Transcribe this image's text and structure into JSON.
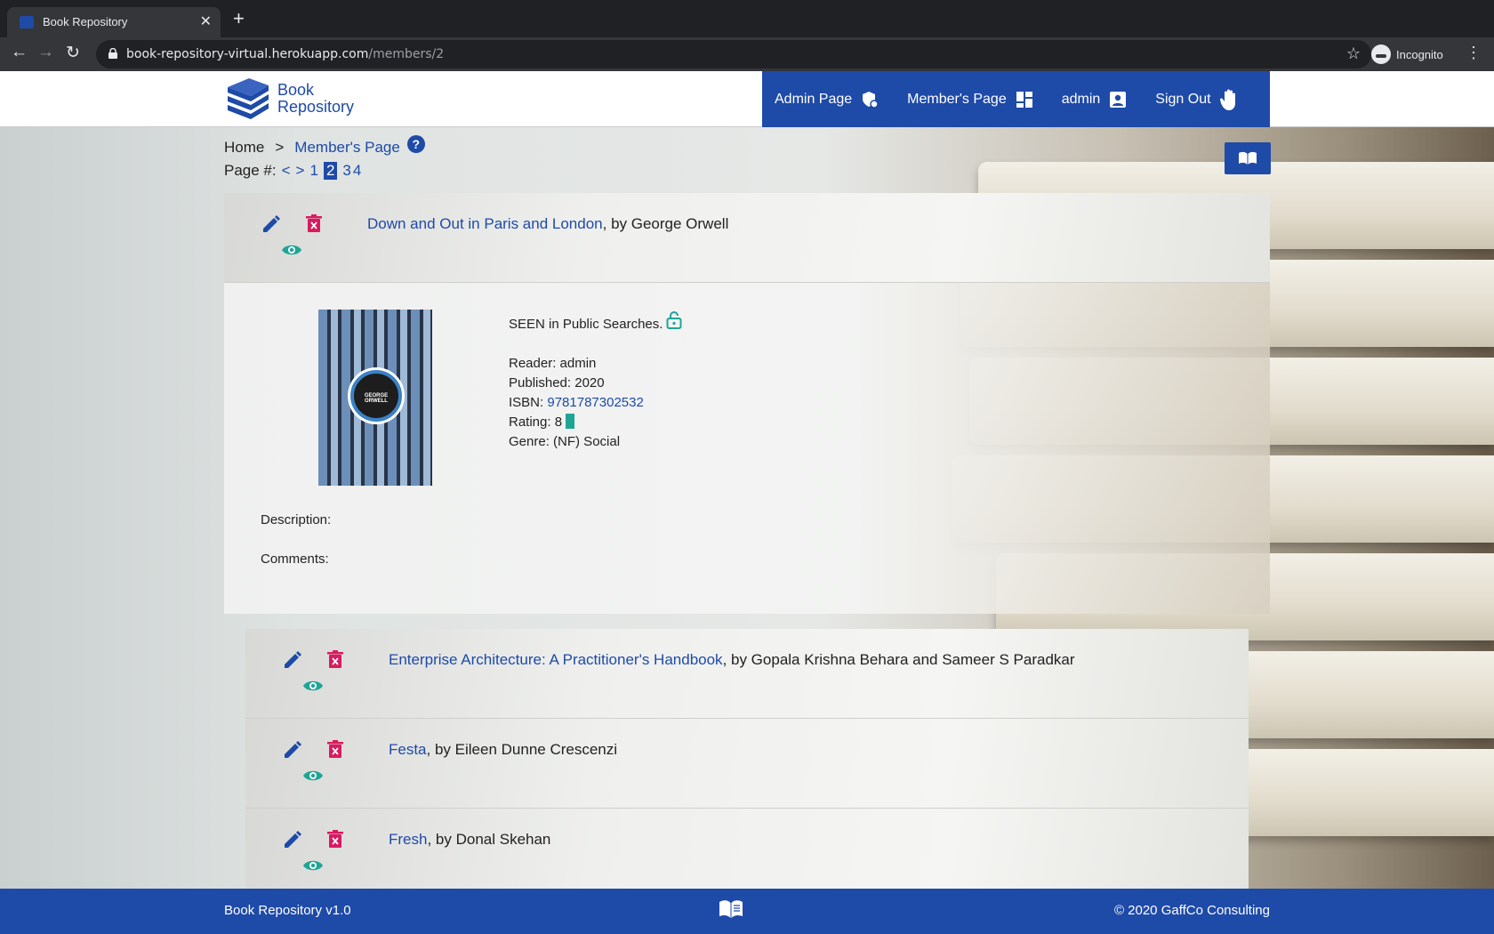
{
  "browser": {
    "tab_title": "Book Repository",
    "url_host": "book-repository-virtual.herokuapp.com",
    "url_path": "/members/2",
    "profile_label": "Incognito"
  },
  "header": {
    "logo_line1": "Book",
    "logo_line2": "Repository",
    "nav": [
      {
        "label": "Admin Page",
        "icon": "shield-icon"
      },
      {
        "label": "Member's Page",
        "icon": "dashboard-icon"
      },
      {
        "label": "admin",
        "icon": "account-box-icon"
      },
      {
        "label": "Sign Out",
        "icon": "hand-icon"
      }
    ]
  },
  "breadcrumb": {
    "home": "Home",
    "separator": ">",
    "current": "Member's Page",
    "help": "?"
  },
  "pager": {
    "label": "Page #:",
    "prev": "<",
    "next": ">",
    "pages": [
      "1",
      "2",
      "3",
      "4"
    ],
    "current": "2"
  },
  "books": [
    {
      "title": "Down and Out in Paris and London",
      "byline": ", by George Orwell"
    },
    {
      "title": "Enterprise Architecture: A Practitioner's Handbook",
      "byline": ", by Gopala Krishna Behara and Sameer S Paradkar"
    },
    {
      "title": "Festa",
      "byline": ", by Eileen Dunne Crescenzi"
    },
    {
      "title": "Fresh",
      "byline": ", by Donal Skehan"
    }
  ],
  "detail": {
    "visibility": "SEEN in Public Searches.",
    "reader_label": "Reader:",
    "reader": "admin",
    "published_label": "Published:",
    "published": "2020",
    "isbn_label": "ISBN:",
    "isbn": "9781787302532",
    "rating_label": "Rating:",
    "rating": "8",
    "genre_label": "Genre:",
    "genre": "(NF) Social",
    "description_label": "Description:",
    "comments_label": "Comments:",
    "cover_author": "GEORGE ORWELL"
  },
  "footer": {
    "version": "Book Repository v1.0",
    "copyright": "© 2020 GaffCo Consulting"
  },
  "colors": {
    "brand": "#1e4aa8",
    "delete": "#d81b60",
    "view": "#1fa596"
  }
}
